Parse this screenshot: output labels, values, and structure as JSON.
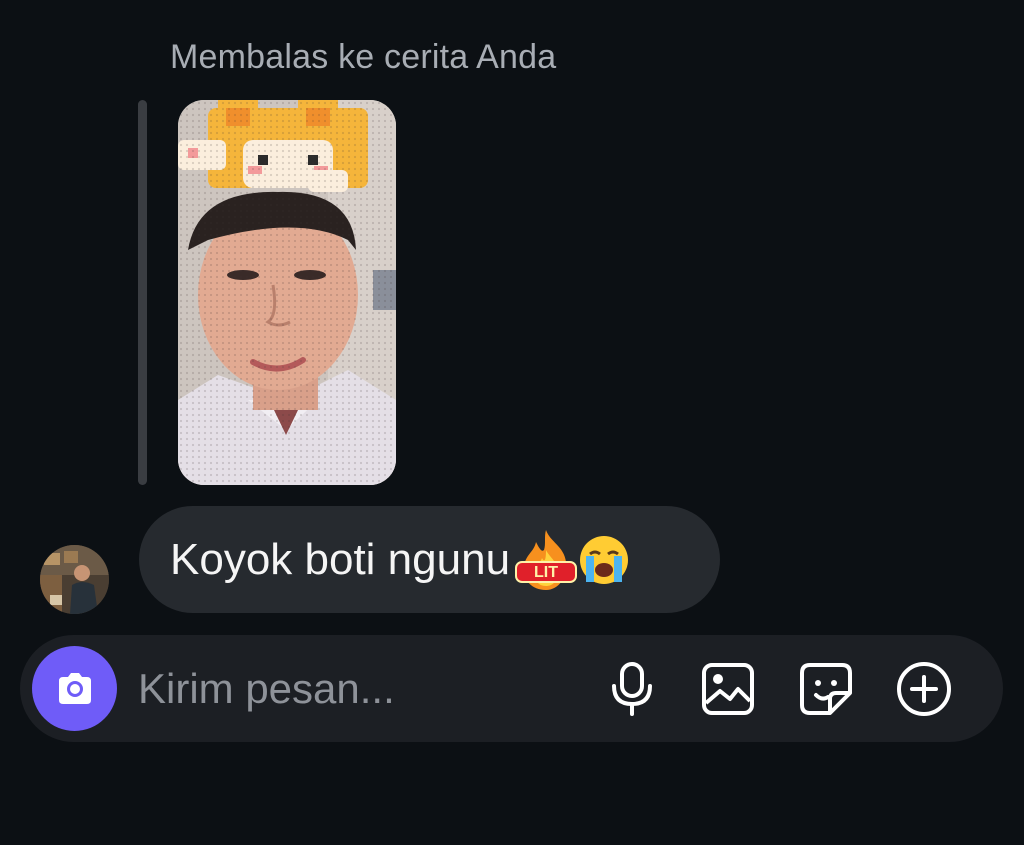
{
  "reply_header": {
    "caption": "Membalas ke cerita Anda"
  },
  "story": {
    "icon": "story-photo-thumbnail"
  },
  "message": {
    "text": "Koyok boti ngunu",
    "emojis": [
      "lit-fire-icon",
      "loudly-crying-face-icon"
    ],
    "lit_label": "LIT"
  },
  "composer": {
    "placeholder": "Kirim pesan...",
    "value": "",
    "camera_icon": "camera-icon",
    "mic_icon": "microphone-icon",
    "gallery_icon": "image-icon",
    "sticker_icon": "sticker-icon",
    "more_icon": "plus-circle-icon"
  },
  "colors": {
    "background": "#0c1014",
    "bubble": "#262a2f",
    "composer": "#1c1f24",
    "accent": "#6f5cf8",
    "caption": "#a8adb4"
  }
}
